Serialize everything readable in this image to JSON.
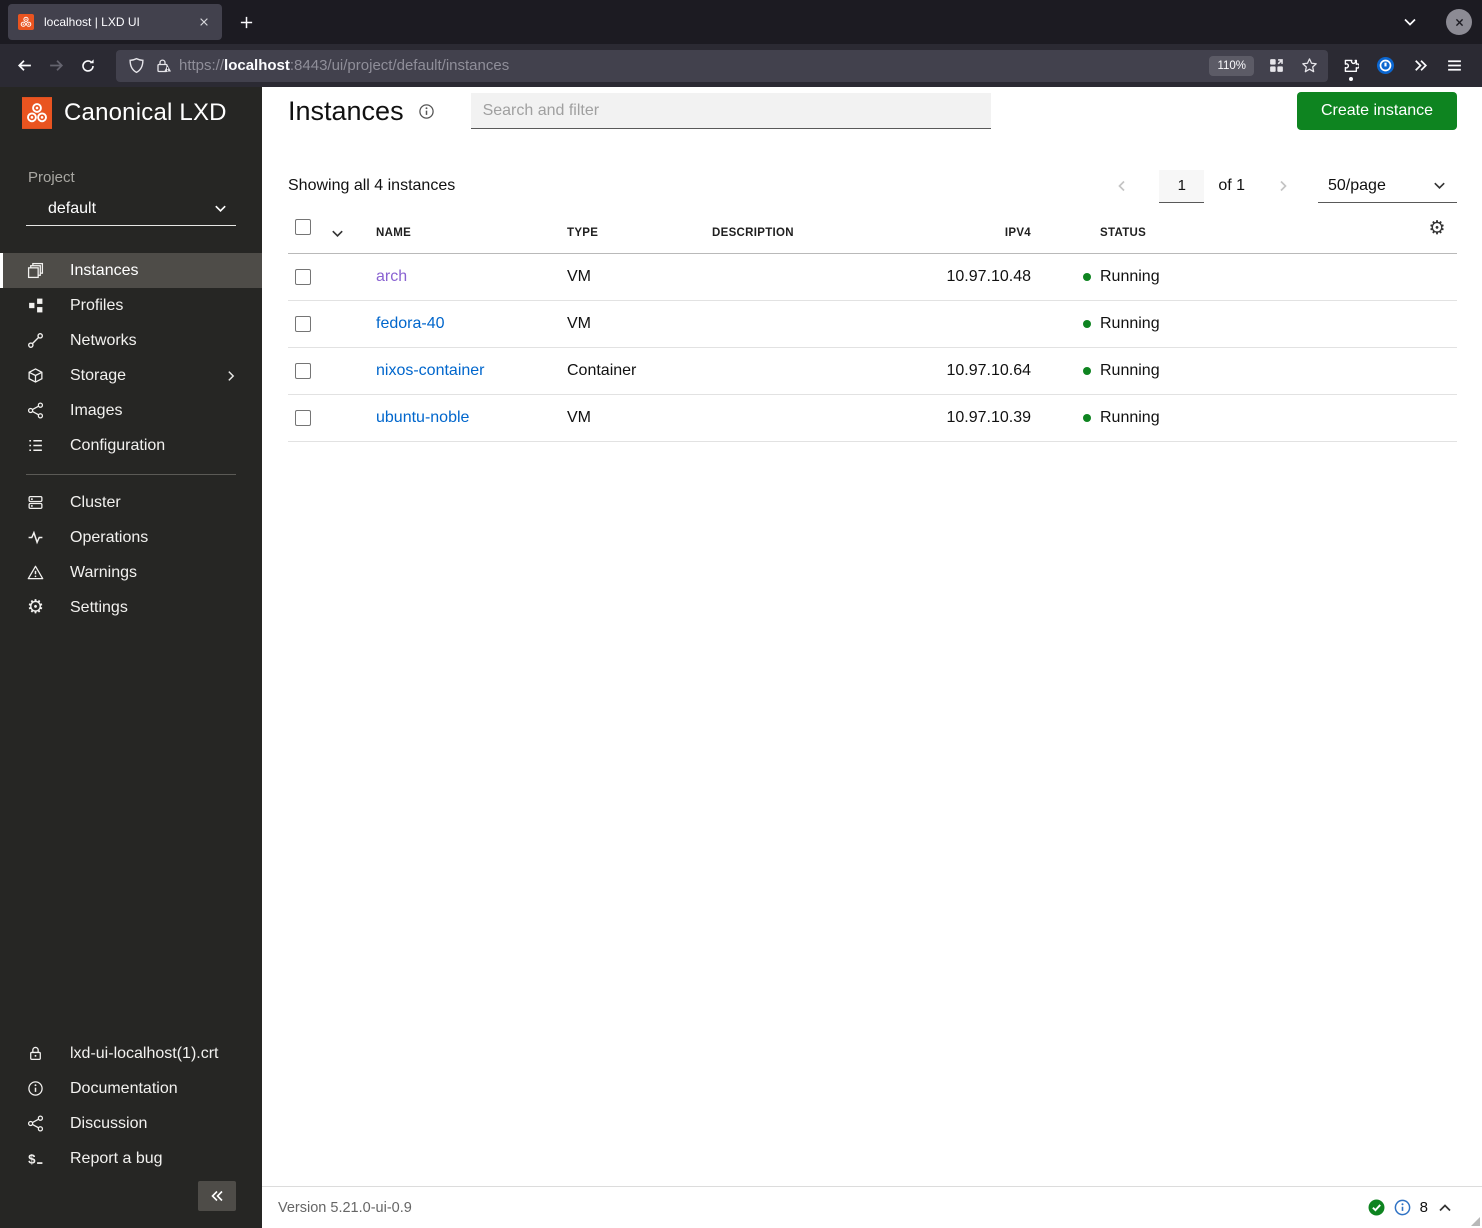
{
  "browser": {
    "tab_title": "localhost | LXD UI",
    "url_prefix": "https://",
    "url_host": "localhost",
    "url_rest": ":8443/ui/project/default/instances",
    "zoom_level": "110%"
  },
  "sidebar": {
    "brand": "Canonical LXD",
    "project_label": "Project",
    "project_value": "default",
    "nav_main": [
      {
        "label": "Instances"
      },
      {
        "label": "Profiles"
      },
      {
        "label": "Networks"
      },
      {
        "label": "Storage"
      },
      {
        "label": "Images"
      },
      {
        "label": "Configuration"
      }
    ],
    "nav_secondary": [
      {
        "label": "Cluster"
      },
      {
        "label": "Operations"
      },
      {
        "label": "Warnings"
      },
      {
        "label": "Settings"
      }
    ],
    "nav_footer": [
      {
        "label": "lxd-ui-localhost(1).crt"
      },
      {
        "label": "Documentation"
      },
      {
        "label": "Discussion"
      },
      {
        "label": "Report a bug"
      }
    ]
  },
  "main": {
    "title": "Instances",
    "search_placeholder": "Search and filter",
    "create_button": "Create instance",
    "summary": "Showing all 4 instances",
    "pagination": {
      "current_page": "1",
      "total_label": "of 1",
      "page_size": "50/page"
    },
    "table": {
      "headers": {
        "name": "NAME",
        "type": "TYPE",
        "description": "DESCRIPTION",
        "ipv4": "IPV4",
        "status": "STATUS"
      },
      "rows": [
        {
          "name": "arch",
          "type": "VM",
          "description": "",
          "ipv4": "10.97.10.48",
          "status": "Running",
          "name_color": "#8a63d2"
        },
        {
          "name": "fedora-40",
          "type": "VM",
          "description": "",
          "ipv4": "",
          "status": "Running",
          "name_color": "#0066cc"
        },
        {
          "name": "nixos-container",
          "type": "Container",
          "description": "",
          "ipv4": "10.97.10.64",
          "status": "Running",
          "name_color": "#0066cc"
        },
        {
          "name": "ubuntu-noble",
          "type": "VM",
          "description": "",
          "ipv4": "10.97.10.39",
          "status": "Running",
          "name_color": "#0066cc"
        }
      ]
    },
    "status_bar": {
      "version": "Version 5.21.0-ui-0.9",
      "operations_count": "8"
    }
  },
  "colors": {
    "accent_green": "#0e8420",
    "brand_orange": "#e95420",
    "link_blue": "#0066cc",
    "link_visited": "#8a63d2",
    "status_running": "#0e8420"
  }
}
